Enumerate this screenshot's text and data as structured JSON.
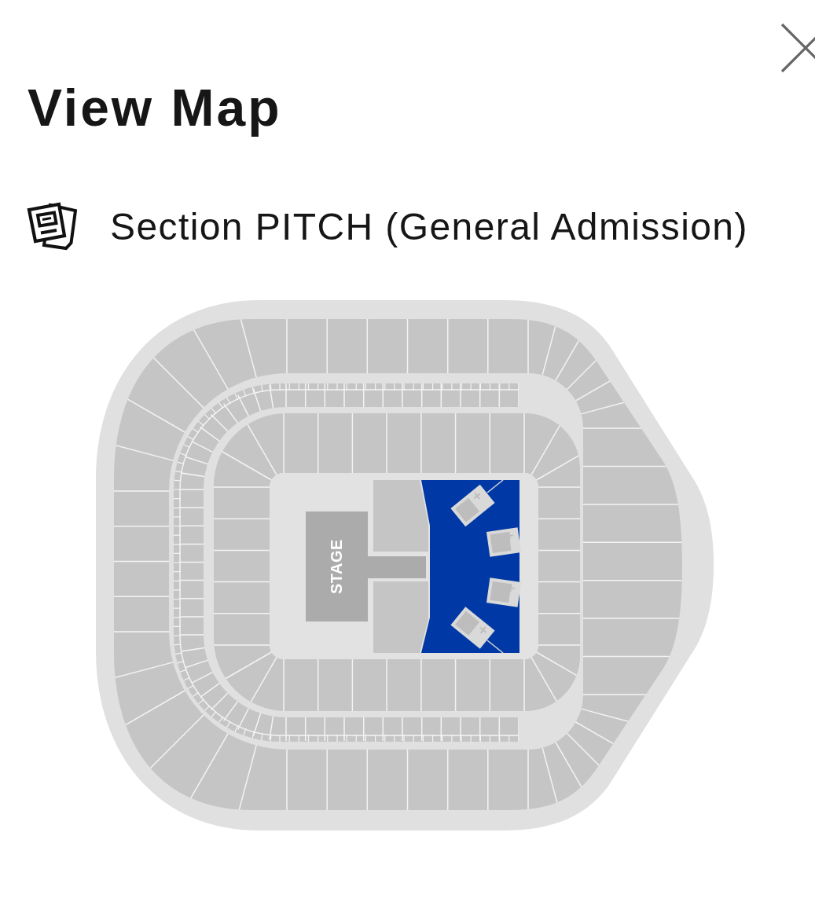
{
  "title": "View Map",
  "section": {
    "label": "Section PITCH (General Admission)"
  },
  "map": {
    "stage_label": "STAGE",
    "floor_sections": [
      {
        "selected": false
      },
      {
        "selected": false
      },
      {
        "selected": true
      }
    ]
  }
}
